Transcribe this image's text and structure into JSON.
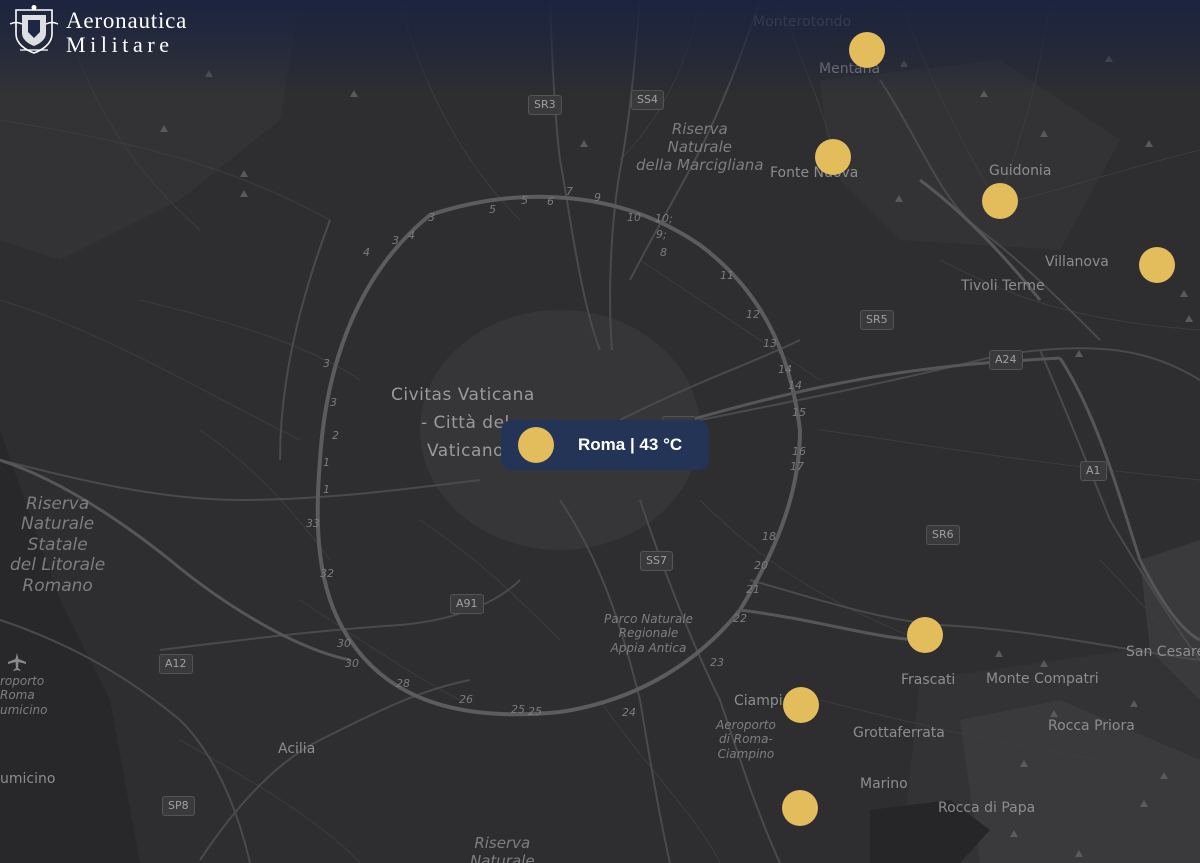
{
  "logo": {
    "line1": "Aeronautica",
    "line2": "Militare"
  },
  "popup": {
    "text": "Roma | 43 °C"
  },
  "places": {
    "monterotondo": "Monterotondo",
    "mentana": "Mentana",
    "fonte_nuova": "Fonte Nuova",
    "guidonia": "Guidonia",
    "villanova": "Villanova",
    "tivoli_terme": "Tivoli Terme",
    "frascati": "Frascati",
    "monte_compatri": "Monte Compatri",
    "san_cesareo": "San Cesare",
    "ciampino": "Ciampi",
    "grottaferrata": "Grottaferrata",
    "rocca_priora": "Rocca Priora",
    "marino": "Marino",
    "rocca_di_papa": "Rocca di Papa",
    "acilia": "Acilia",
    "fiumicino": "umicino",
    "vatican_line1": "Civitas Vaticana",
    "vatican_line2": "- Città del",
    "vatican_line3": "Vaticano"
  },
  "parks": {
    "marcigliana": [
      "Riserva",
      "Naturale",
      "della Marcigliana"
    ],
    "litorale": [
      "Riserva",
      "Naturale",
      "Statale",
      "del Litorale",
      "Romano"
    ],
    "appia": [
      "Parco Naturale",
      "Regionale",
      "Appia Antica"
    ],
    "airport_ciampino": [
      "Aeroporto",
      "di Roma-",
      "Ciampino"
    ],
    "airport_fiumicino": [
      "roporto",
      "Roma",
      "umicino"
    ],
    "riserva_south": [
      "Riserva",
      "Naturale"
    ]
  },
  "roads": {
    "sr3": "SR3",
    "ss4": "SS4",
    "sr5": "SR5",
    "a24_east": "A24",
    "a24_center": "A24",
    "a1": "A1",
    "sr6": "SR6",
    "ss7": "SS7",
    "a91": "A91",
    "a12": "A12",
    "sp8": "SP8"
  },
  "exits": [
    "3",
    "4",
    "4",
    "3",
    "5",
    "5",
    "6",
    "7",
    "9",
    "10",
    "10;",
    "9;",
    "8",
    "11",
    "12",
    "13",
    "14",
    "14",
    "15",
    "16",
    "17",
    "18",
    "20",
    "21",
    "22",
    "23",
    "24",
    "25",
    "25",
    "26",
    "28",
    "30",
    "30",
    "32",
    "33",
    "1",
    "1",
    "2",
    "3",
    "3"
  ],
  "markers": [
    {
      "name": "weather-marker-mentana"
    },
    {
      "name": "weather-marker-fonte-nuova"
    },
    {
      "name": "weather-marker-guidonia"
    },
    {
      "name": "weather-marker-tivoli"
    },
    {
      "name": "weather-marker-frascati"
    },
    {
      "name": "weather-marker-ciampino"
    },
    {
      "name": "weather-marker-marino"
    }
  ],
  "colors": {
    "marker": "#e3bc5c",
    "popup_bg": "#243457",
    "header_band": "#1a2340",
    "map_bg": "#2e2e30"
  }
}
